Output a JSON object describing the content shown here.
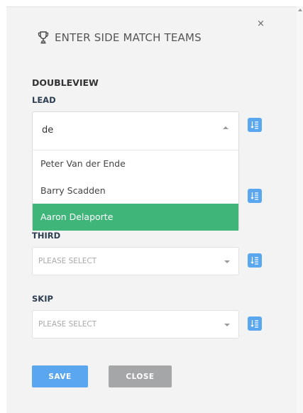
{
  "dialog": {
    "title": "ENTER SIDE MATCH TEAMS",
    "close_symbol": "×",
    "icon": "trophy-icon",
    "team_name": "DOUBLEVIEW"
  },
  "positions": {
    "lead": {
      "label": "LEAD",
      "search_value": "de",
      "options": [
        "Peter Van der Ende",
        "Barry Scadden",
        "Aaron Delaporte"
      ],
      "highlighted_index": 2
    },
    "third": {
      "label": "THIRD",
      "placeholder": "PLEASE SELECT"
    },
    "skip": {
      "label": "SKIP",
      "placeholder": "PLEASE SELECT"
    }
  },
  "actions": {
    "save_label": "SAVE",
    "close_label": "CLOSE"
  },
  "colors": {
    "accent": "#5aa7ef",
    "highlight": "#3fb57a",
    "close_button": "#a5a6a8",
    "panel": "#f3f3f4"
  }
}
